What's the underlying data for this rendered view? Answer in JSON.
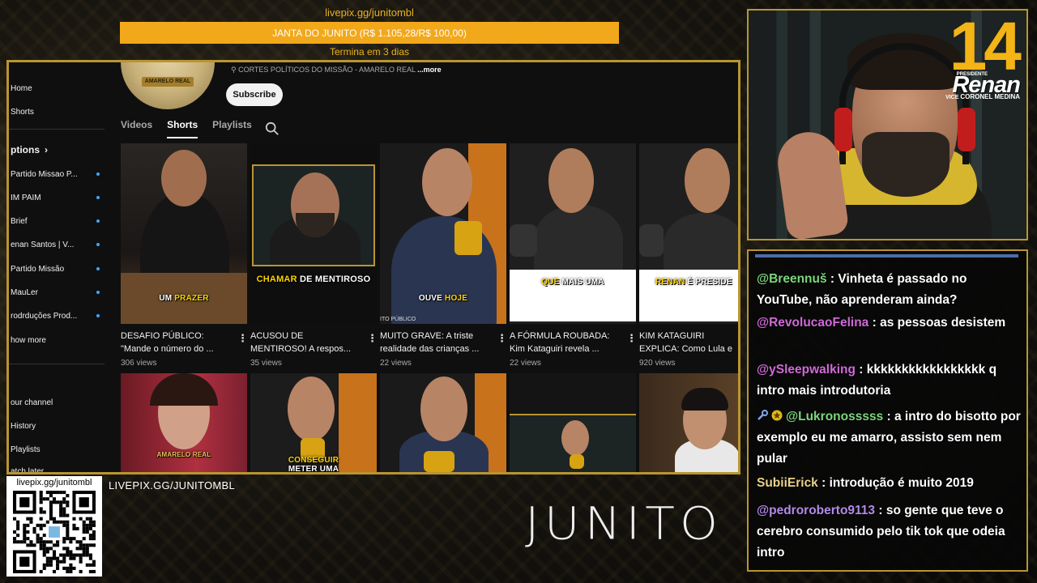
{
  "donation": {
    "url": "livepix.gg/junitombl",
    "goal_label": "JANTA DO JUNITO (R$ 1.105,28/R$ 100,00)",
    "progress_fraction": 1.0,
    "ends": "Termina em 3 dias"
  },
  "youtube": {
    "sidebar": {
      "items": [
        {
          "label": "Home",
          "dot": false
        },
        {
          "label": "Shorts",
          "dot": false
        },
        {
          "label": "ptions",
          "dot": false,
          "bold": true
        },
        {
          "label": "Partido Missao P...",
          "dot": true
        },
        {
          "label": "IM PAIM",
          "dot": true
        },
        {
          "label": "Brief",
          "dot": true
        },
        {
          "label": "enan Santos | V...",
          "dot": true
        },
        {
          "label": "Partido Missão",
          "dot": true
        },
        {
          "label": "MauLer",
          "dot": true
        },
        {
          "label": "rodrduções Prod...",
          "dot": true
        },
        {
          "label": "how more",
          "dot": false
        },
        {
          "label": "our channel",
          "dot": false
        },
        {
          "label": "History",
          "dot": false
        },
        {
          "label": "Playlists",
          "dot": false
        },
        {
          "label": "atch later",
          "dot": false
        }
      ]
    },
    "channel": {
      "avatar_text": "AMARELO REAL",
      "description": "CORTES POLÍTICOS DO MISSÃO - AMARELO REAL",
      "more": "...more",
      "subscribe_label": "Subscribe"
    },
    "tabs": [
      "Videos",
      "Shorts",
      "Playlists"
    ],
    "active_tab": "Shorts",
    "shorts": [
      {
        "title": "DESAFIO PÚBLICO: \"Mande o número do ...",
        "views": "306 views",
        "caption_white": "UM",
        "caption_yellow": "PRAZER"
      },
      {
        "title": "ACUSOU DE MENTIROSO! A respos...",
        "views": "35 views",
        "caption_yellow": "CHAMAR",
        "caption_white": "DE MENTIROSO"
      },
      {
        "title": "MUITO GRAVE: A triste realidade das crianças ...",
        "views": "22 views",
        "caption_white": "OUVE",
        "caption_yellow": "HOJE",
        "top_text": "ITO PÚBLICO"
      },
      {
        "title": "A FÓRMULA ROUBADA: Kim Kataguiri revela ...",
        "views": "22 views",
        "caption_yellow": "QUE",
        "caption_white": "MAIS UMA"
      },
      {
        "title": "KIM KATAGUIRI EXPLICA: Como Lula e",
        "views": "920 views",
        "caption_yellow": "RENAN",
        "caption_white": "É PRESIDE"
      }
    ],
    "shorts_row2": [
      {
        "caption": "AMARELO REAL"
      },
      {
        "caption_yellow": "CONSEGUIR",
        "caption_white": "METER UMA"
      },
      {
        "caption": ""
      },
      {
        "caption": ""
      },
      {
        "caption": ""
      }
    ]
  },
  "webcam": {
    "logo_number": "14",
    "logo_presidente": "PRESIDENTE",
    "logo_name": "Renan",
    "logo_vice_prefix": "VICE",
    "logo_vice_name": "CORONEL MEDINA"
  },
  "chat": {
    "messages": [
      {
        "user": "@Breennuš",
        "user_color": "#7cd67c",
        "text": "Vinheta é passado no YouTube, não aprenderam ainda?"
      },
      {
        "user": "@RevolucaoFelina",
        "user_color": "#d06ad8",
        "text": "as pessoas desistem"
      },
      {
        "user": "@ySleepwalking",
        "user_color": "#d06ad8",
        "text": "kkkkkkkkkkkkkkkkk q intro mais introdutoria"
      },
      {
        "user": "@Lukronosssss",
        "user_color": "#7cd67c",
        "text": "a intro do bisotto por exemplo eu me amarro, assisto sem nem pular",
        "badges": [
          "wrench-icon",
          "star-badge-icon"
        ]
      },
      {
        "user": "SubiiErick",
        "user_color": "#e8d28a",
        "text": "introdução é muito 2019"
      },
      {
        "user": "@pedroroberto9113",
        "user_color": "#b38ae8",
        "text": "so gente que teve o cerebro consumido pelo tik tok que odeia intro"
      }
    ]
  },
  "qr": {
    "url": "livepix.gg/junitombl"
  },
  "bottom_url": "LIVEPIX.GG/JUNITOMBL",
  "brand": "JUNITO",
  "colors": {
    "accent_gold": "#b89532",
    "goal_orange": "#f2a81b",
    "logo_yellow": "#f4b416"
  }
}
